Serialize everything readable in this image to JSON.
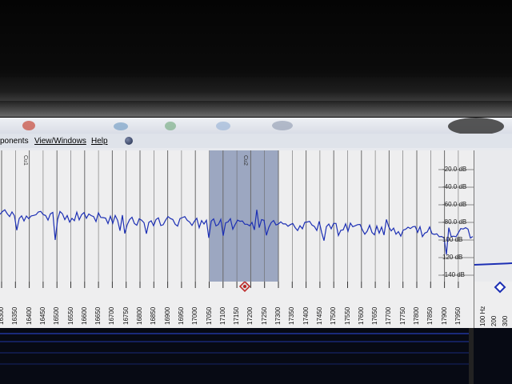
{
  "menu": {
    "components_label": "ponents",
    "view_windows_label": "View/Windows",
    "help_label": "Help"
  },
  "spectrum": {
    "db_labels": [
      "-20.0 dB",
      "-40.0 dB",
      "-60.0 dB",
      "-80.0 dB",
      "100 dB",
      "120 dB",
      "-140 dB"
    ],
    "freq_ticks": [
      "16300",
      "16350",
      "16400",
      "16450",
      "16500",
      "16550",
      "16600",
      "16650",
      "16700",
      "16750",
      "16800",
      "16850",
      "16900",
      "16950",
      "17000",
      "17050",
      "17100",
      "17150",
      "17200",
      "17250",
      "17300",
      "17350",
      "17400",
      "17450",
      "17500",
      "17550",
      "17600",
      "17650",
      "17700",
      "17750",
      "17800",
      "17850",
      "17900",
      "17950"
    ],
    "marker_1": "Cu1",
    "marker_2": "Cu2",
    "side_ticks": [
      "100 Hz",
      "200",
      "300"
    ],
    "colors": {
      "trace": "#1c2fb4",
      "selection": "#8d9ab8",
      "grid": "#6a6a6a"
    }
  }
}
